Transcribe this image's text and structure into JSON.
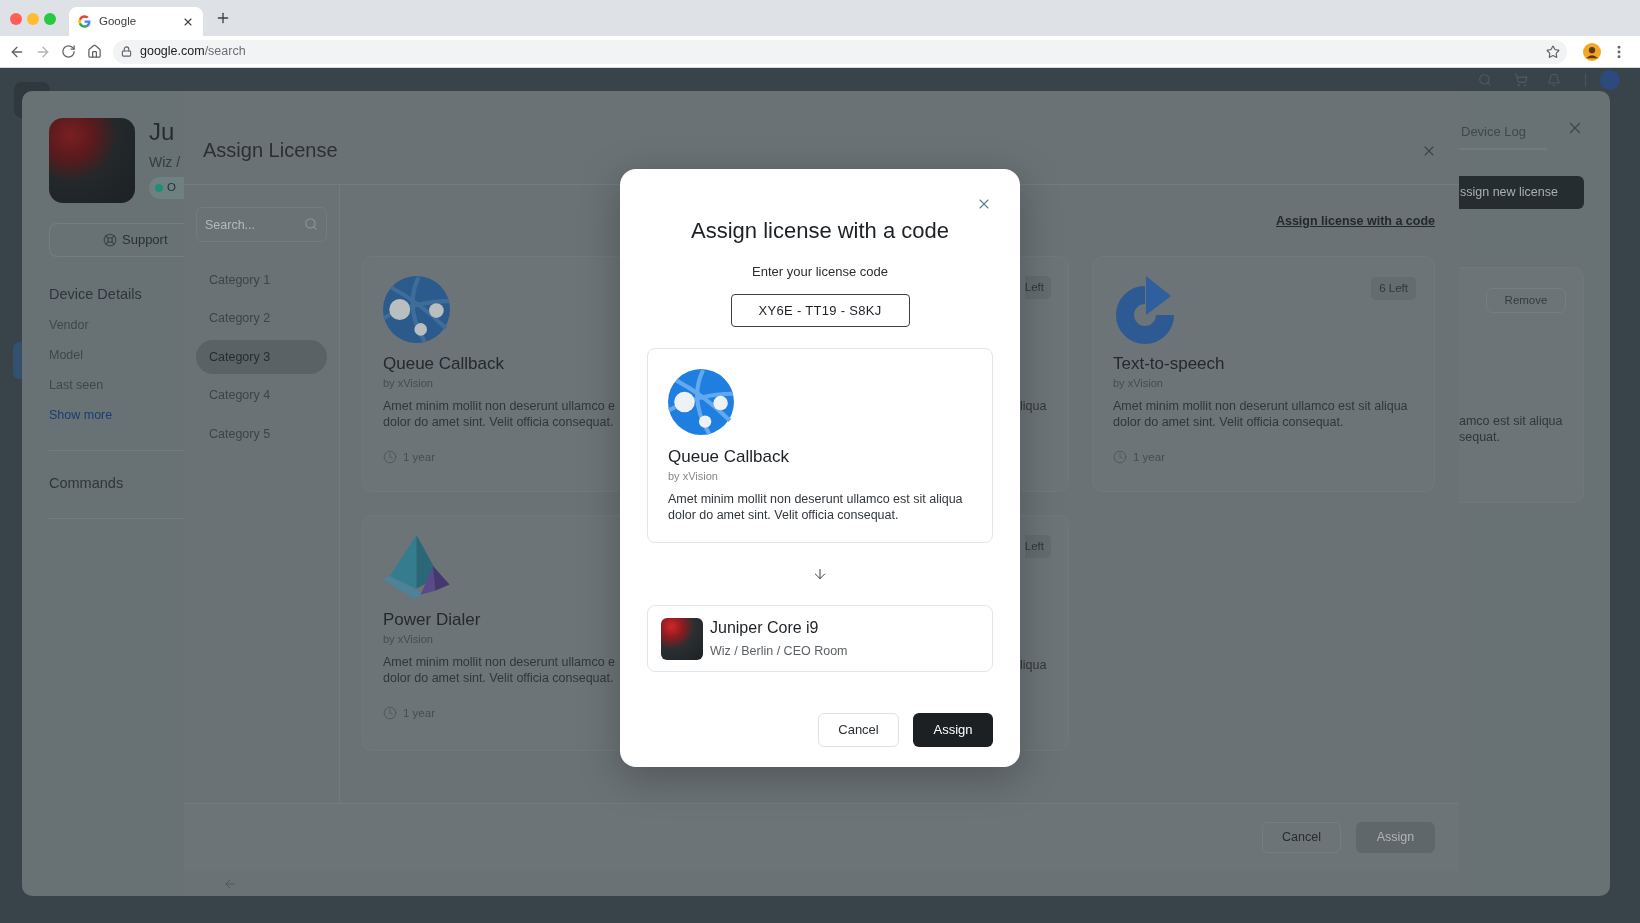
{
  "browser": {
    "tab_title": "Google",
    "url_host": "google.com",
    "url_path": "/search"
  },
  "device_panel": {
    "title": "Ju",
    "location": "Wiz /",
    "status": "O",
    "support_button": "Support",
    "details_heading": "Device Details",
    "detail_fields": [
      "Vendor",
      "Model",
      "Last seen"
    ],
    "show_more": "Show more",
    "commands_heading": "Commands",
    "log_tab": "Device Log",
    "assign_button": "ssign new license",
    "license_card": {
      "remove_button": "Remove",
      "description_lines": [
        "amco est sit aliqua",
        "sequat."
      ]
    }
  },
  "drawer": {
    "title": "Assign License",
    "search": {
      "placeholder": "Search..."
    },
    "categories": [
      {
        "label": "Category 1",
        "selected": false
      },
      {
        "label": "Category 2",
        "selected": false
      },
      {
        "label": "Category 3",
        "selected": true
      },
      {
        "label": "Category 4",
        "selected": false
      },
      {
        "label": "Category 5",
        "selected": false
      }
    ],
    "code_link": "Assign license with a code",
    "license_rows": [
      [
        {
          "kind": "left_part",
          "title": "Queue Callback",
          "vendor": "by xVision",
          "description_lines": [
            "Amet minim mollit non deserunt ullamco e",
            "dolor do amet sint. Velit officia consequat."
          ],
          "duration": "1 year"
        },
        {
          "kind": "right_part",
          "badge": "Left",
          "description_lines": [
            "liqua"
          ]
        },
        {
          "kind": "full",
          "badge": "6 Left",
          "title": "Text-to-speech",
          "vendor": "by xVision",
          "description": "Amet minim mollit non deserunt ullamco est sit aliqua dolor do amet sint. Velit officia consequat.",
          "duration": "1 year"
        }
      ],
      [
        {
          "kind": "left_part",
          "title": "Power Dialer",
          "vendor": "by xVision",
          "description_lines": [
            "Amet minim mollit non deserunt ullamco e",
            "dolor do amet sint. Velit officia consequat."
          ],
          "duration": "1 year"
        },
        {
          "kind": "right_part",
          "badge": "Left",
          "description_lines": [
            "liqua"
          ]
        }
      ]
    ],
    "footer_buttons": [
      {
        "label": "Cancel",
        "kind": "secondary",
        "disabled": false
      },
      {
        "label": "Assign",
        "kind": "primary",
        "disabled": true
      }
    ]
  },
  "modal": {
    "title": "Assign license with a code",
    "prompt": "Enter your license code",
    "code": "XY6E - TT19 - S8KJ",
    "license": {
      "title": "Queue Callback",
      "vendor": "by xVision",
      "description": "Amet minim mollit non deserunt ullamco est sit aliqua dolor do amet sint. Velit officia consequat."
    },
    "device": {
      "name": "Juniper Core i9",
      "path": "Wiz / Berlin / CEO Room"
    },
    "buttons": [
      {
        "label": "Cancel",
        "kind": "secondary"
      },
      {
        "label": "Assign",
        "kind": "primary"
      }
    ]
  }
}
